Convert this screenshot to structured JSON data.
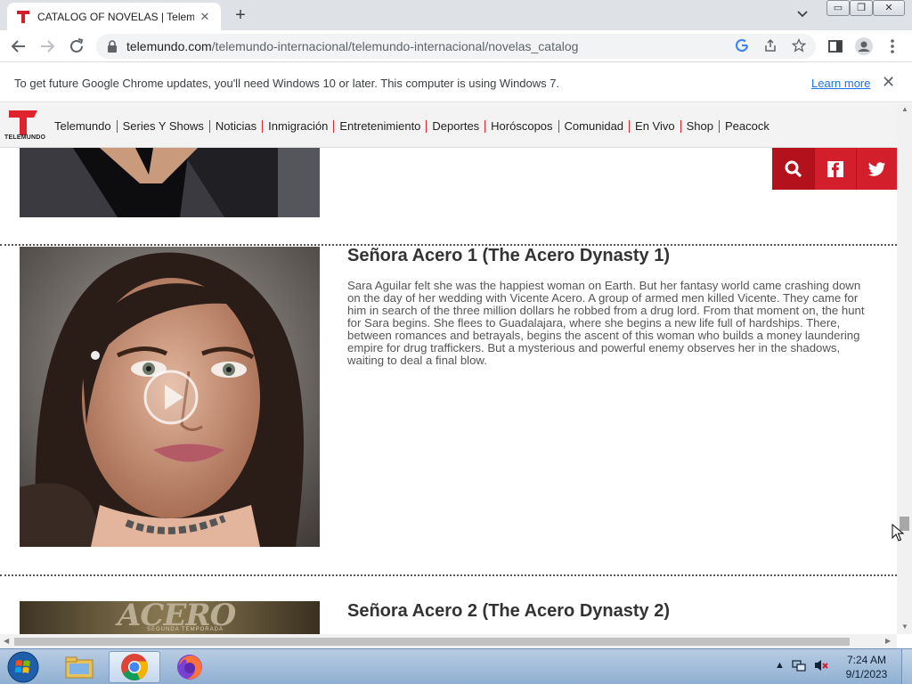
{
  "browser": {
    "tab_title": "CATALOG OF NOVELAS | Telemundo",
    "new_tab_label": "+",
    "tab_close": "✕",
    "url_host": "telemundo.com",
    "url_path": "/telemundo-internacional/telemundo-internacional/novelas_catalog",
    "window_controls": [
      "▭",
      "❐",
      "✕"
    ]
  },
  "infobar": {
    "message": "To get future Google Chrome updates, you'll need Windows 10 or later. This computer is using Windows 7.",
    "link": "Learn more",
    "close": "✕"
  },
  "site": {
    "logo_text": "TELEMUNDO",
    "brand_color": "#d21f2b",
    "nav": [
      "Telemundo",
      "Series Y Shows",
      "Noticias",
      "Inmigración",
      "Entretenimiento",
      "Deportes",
      "Horóscopos",
      "Comunidad",
      "En Vivo",
      "Shop",
      "Peacock"
    ],
    "social_icons": [
      "search-icon",
      "facebook-icon",
      "twitter-icon"
    ]
  },
  "shows": [
    {
      "title": "Señora Acero 1 (The Acero Dynasty 1)",
      "description": "Sara Aguilar felt she was the happiest woman on Earth. But her fantasy world came crashing down on the day of her wedding with Vicente Acero. A group of armed men killed Vicente. They came for him in search of the three million dollars he robbed from a drug lord. From that moment on, the hunt for Sara begins. She flees to Guadalajara, where she begins a new life full of hardships. There, between romances and betrayals, begins the ascent of this woman who builds a money laundering empire for drug traffickers. But a mysterious and powerful enemy observes her in the shadows, waiting to deal a final blow."
    },
    {
      "title": "Señora Acero 2 (The Acero Dynasty 2)",
      "image_text": "ACERO",
      "image_subtext": "SEGUNDA TEMPORADA"
    }
  ],
  "taskbar": {
    "time": "7:24 AM",
    "date": "9/1/2023"
  }
}
